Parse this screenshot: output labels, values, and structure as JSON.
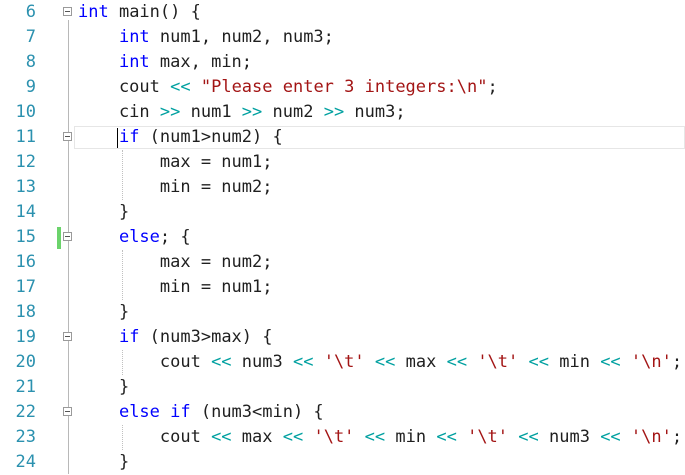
{
  "editor": {
    "lines": [
      {
        "num": "6",
        "fold": true,
        "tokens": [
          {
            "t": "int",
            "c": "kw"
          },
          {
            "t": " main() {",
            "c": ""
          }
        ]
      },
      {
        "num": "7",
        "fold": false,
        "tokens": [
          {
            "t": "    ",
            "c": ""
          },
          {
            "t": "int",
            "c": "kw"
          },
          {
            "t": " num1, num2, num3;",
            "c": ""
          }
        ]
      },
      {
        "num": "8",
        "fold": false,
        "tokens": [
          {
            "t": "    ",
            "c": ""
          },
          {
            "t": "int",
            "c": "kw"
          },
          {
            "t": " max, min;",
            "c": ""
          }
        ]
      },
      {
        "num": "9",
        "fold": false,
        "tokens": [
          {
            "t": "    cout ",
            "c": ""
          },
          {
            "t": "<<",
            "c": "op"
          },
          {
            "t": " ",
            "c": ""
          },
          {
            "t": "\"Please enter 3 integers:\\n\"",
            "c": "str"
          },
          {
            "t": ";",
            "c": ""
          }
        ]
      },
      {
        "num": "10",
        "fold": false,
        "tokens": [
          {
            "t": "    cin ",
            "c": ""
          },
          {
            "t": ">>",
            "c": "op"
          },
          {
            "t": " num1 ",
            "c": ""
          },
          {
            "t": ">>",
            "c": "op"
          },
          {
            "t": " num2 ",
            "c": ""
          },
          {
            "t": ">>",
            "c": "op"
          },
          {
            "t": " num3;",
            "c": ""
          }
        ]
      },
      {
        "num": "11",
        "fold": true,
        "tokens": [
          {
            "t": "    ",
            "c": ""
          },
          {
            "t": "if",
            "c": "kw"
          },
          {
            "t": " (num1>num2) {",
            "c": ""
          }
        ]
      },
      {
        "num": "12",
        "fold": false,
        "tokens": [
          {
            "t": "        max = num1;",
            "c": ""
          }
        ]
      },
      {
        "num": "13",
        "fold": false,
        "tokens": [
          {
            "t": "        min = num2;",
            "c": ""
          }
        ]
      },
      {
        "num": "14",
        "fold": false,
        "tokens": [
          {
            "t": "    }",
            "c": ""
          }
        ]
      },
      {
        "num": "15",
        "fold": true,
        "tokens": [
          {
            "t": "    ",
            "c": ""
          },
          {
            "t": "else",
            "c": "kw"
          },
          {
            "t": "; {",
            "c": ""
          }
        ]
      },
      {
        "num": "16",
        "fold": false,
        "tokens": [
          {
            "t": "        max = num2;",
            "c": ""
          }
        ]
      },
      {
        "num": "17",
        "fold": false,
        "tokens": [
          {
            "t": "        min = num1;",
            "c": ""
          }
        ]
      },
      {
        "num": "18",
        "fold": false,
        "tokens": [
          {
            "t": "    }",
            "c": ""
          }
        ]
      },
      {
        "num": "19",
        "fold": true,
        "tokens": [
          {
            "t": "    ",
            "c": ""
          },
          {
            "t": "if",
            "c": "kw"
          },
          {
            "t": " (num3>max) {",
            "c": ""
          }
        ]
      },
      {
        "num": "20",
        "fold": false,
        "tokens": [
          {
            "t": "        cout ",
            "c": ""
          },
          {
            "t": "<<",
            "c": "op"
          },
          {
            "t": " num3 ",
            "c": ""
          },
          {
            "t": "<<",
            "c": "op"
          },
          {
            "t": " ",
            "c": ""
          },
          {
            "t": "'\\t'",
            "c": "str"
          },
          {
            "t": " ",
            "c": ""
          },
          {
            "t": "<<",
            "c": "op"
          },
          {
            "t": " max ",
            "c": ""
          },
          {
            "t": "<<",
            "c": "op"
          },
          {
            "t": " ",
            "c": ""
          },
          {
            "t": "'\\t'",
            "c": "str"
          },
          {
            "t": " ",
            "c": ""
          },
          {
            "t": "<<",
            "c": "op"
          },
          {
            "t": " min ",
            "c": ""
          },
          {
            "t": "<<",
            "c": "op"
          },
          {
            "t": " ",
            "c": ""
          },
          {
            "t": "'\\n'",
            "c": "str"
          },
          {
            "t": ";",
            "c": ""
          }
        ]
      },
      {
        "num": "21",
        "fold": false,
        "tokens": [
          {
            "t": "    }",
            "c": ""
          }
        ]
      },
      {
        "num": "22",
        "fold": true,
        "tokens": [
          {
            "t": "    ",
            "c": ""
          },
          {
            "t": "else if",
            "c": "kw"
          },
          {
            "t": " (num3<min) {",
            "c": ""
          }
        ]
      },
      {
        "num": "23",
        "fold": false,
        "tokens": [
          {
            "t": "        cout ",
            "c": ""
          },
          {
            "t": "<<",
            "c": "op"
          },
          {
            "t": " max ",
            "c": ""
          },
          {
            "t": "<<",
            "c": "op"
          },
          {
            "t": " ",
            "c": ""
          },
          {
            "t": "'\\t'",
            "c": "str"
          },
          {
            "t": " ",
            "c": ""
          },
          {
            "t": "<<",
            "c": "op"
          },
          {
            "t": " min ",
            "c": ""
          },
          {
            "t": "<<",
            "c": "op"
          },
          {
            "t": " ",
            "c": ""
          },
          {
            "t": "'\\t'",
            "c": "str"
          },
          {
            "t": " ",
            "c": ""
          },
          {
            "t": "<<",
            "c": "op"
          },
          {
            "t": " num3 ",
            "c": ""
          },
          {
            "t": "<<",
            "c": "op"
          },
          {
            "t": " ",
            "c": ""
          },
          {
            "t": "'\\n'",
            "c": "str"
          },
          {
            "t": ";",
            "c": ""
          }
        ]
      },
      {
        "num": "24",
        "fold": false,
        "tokens": [
          {
            "t": "    }",
            "c": ""
          }
        ]
      }
    ],
    "colors": {
      "keyword": "#0000ff",
      "string": "#a31515",
      "operator": "#00a0a0",
      "line_number": "#2b91af",
      "change_marker": "#6bd36b"
    }
  }
}
